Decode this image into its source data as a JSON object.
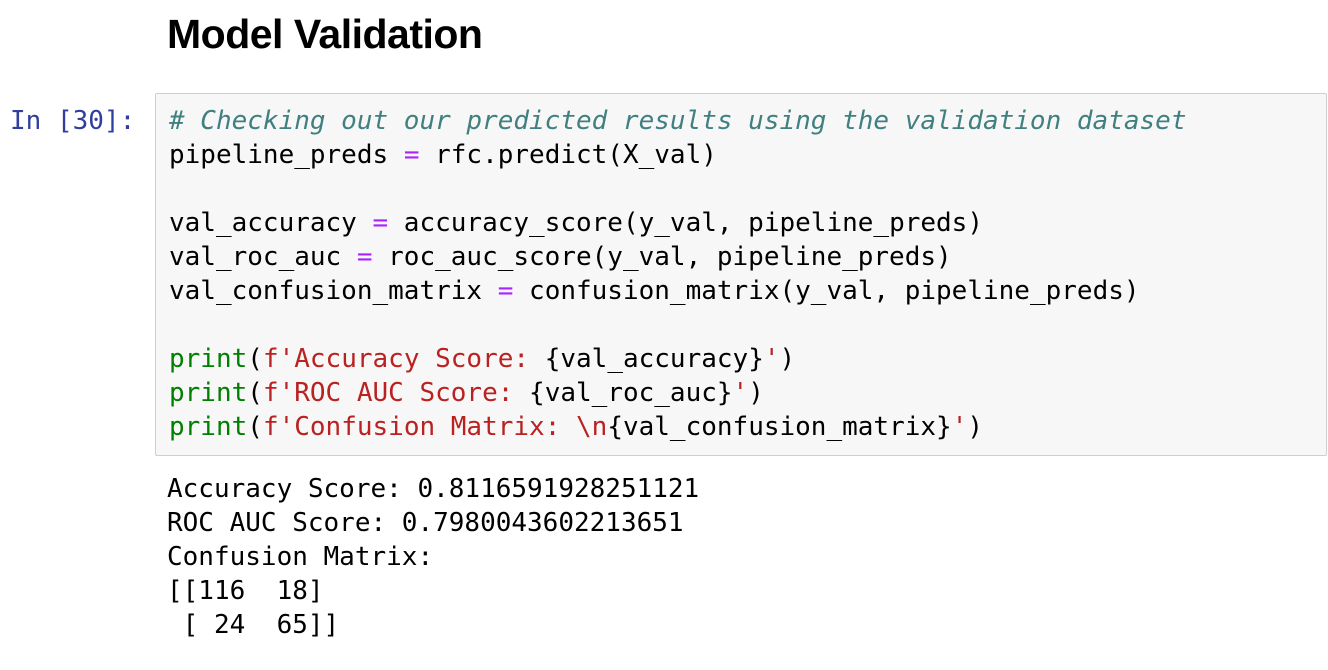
{
  "heading": "Model Validation",
  "cell": {
    "prompt": "In [30]:",
    "code_lines": [
      [
        {
          "t": "# Checking out our predicted results using the validation dataset",
          "c": "cm-comment"
        }
      ],
      [
        {
          "t": "pipeline_preds ",
          "c": ""
        },
        {
          "t": "=",
          "c": "cm-op"
        },
        {
          "t": " rfc.predict(X_val)",
          "c": ""
        }
      ],
      [],
      [
        {
          "t": "val_accuracy ",
          "c": ""
        },
        {
          "t": "=",
          "c": "cm-op"
        },
        {
          "t": " accuracy_score(y_val, pipeline_preds)",
          "c": ""
        }
      ],
      [
        {
          "t": "val_roc_auc ",
          "c": ""
        },
        {
          "t": "=",
          "c": "cm-op"
        },
        {
          "t": " roc_auc_score(y_val, pipeline_preds)",
          "c": ""
        }
      ],
      [
        {
          "t": "val_confusion_matrix ",
          "c": ""
        },
        {
          "t": "=",
          "c": "cm-op"
        },
        {
          "t": " confusion_matrix(y_val, pipeline_preds)",
          "c": ""
        }
      ],
      [],
      [
        {
          "t": "print",
          "c": "cm-builtin"
        },
        {
          "t": "(",
          "c": ""
        },
        {
          "t": "f'Accuracy Score: ",
          "c": "cm-string"
        },
        {
          "t": "{val_accuracy}",
          "c": ""
        },
        {
          "t": "'",
          "c": "cm-string"
        },
        {
          "t": ")",
          "c": ""
        }
      ],
      [
        {
          "t": "print",
          "c": "cm-builtin"
        },
        {
          "t": "(",
          "c": ""
        },
        {
          "t": "f'ROC AUC Score: ",
          "c": "cm-string"
        },
        {
          "t": "{val_roc_auc}",
          "c": ""
        },
        {
          "t": "'",
          "c": "cm-string"
        },
        {
          "t": ")",
          "c": ""
        }
      ],
      [
        {
          "t": "print",
          "c": "cm-builtin"
        },
        {
          "t": "(",
          "c": ""
        },
        {
          "t": "f'Confusion Matrix: \\n",
          "c": "cm-string"
        },
        {
          "t": "{val_confusion_matrix}",
          "c": ""
        },
        {
          "t": "'",
          "c": "cm-string"
        },
        {
          "t": ")",
          "c": ""
        }
      ]
    ],
    "output_lines": [
      "Accuracy Score: 0.8116591928251121",
      "ROC AUC Score: 0.7980043602213651",
      "Confusion Matrix:",
      "[[116  18]",
      " [ 24  65]]"
    ]
  },
  "colors": {
    "prompt": "#303F9F",
    "comment": "#408080",
    "builtin": "#008000",
    "string": "#BA2121",
    "operator": "#AA22FF",
    "cell_background": "#f7f7f7",
    "cell_border": "#cfcfcf"
  }
}
